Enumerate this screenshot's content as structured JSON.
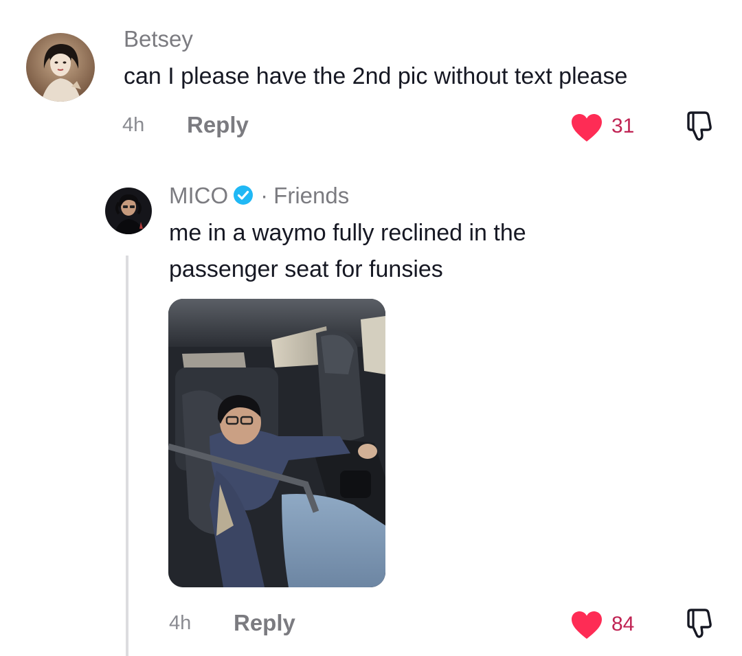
{
  "colors": {
    "like_heart": "#fe2c55",
    "like_count": "#c02454",
    "verified_badge": "#20b8f5",
    "muted_text": "#7b7b80"
  },
  "comments": [
    {
      "username": "Betsey",
      "text": "can I please have the 2nd pic without text please",
      "time": "4h",
      "reply_label": "Reply",
      "likes": "31",
      "liked": true,
      "icons": [
        "heart-icon",
        "dislike-icon"
      ]
    }
  ],
  "replies": [
    {
      "username": "MICO",
      "verified": true,
      "relation_separator": "·",
      "relation": "Friends",
      "text_line1": "me in a waymo fully reclined in the",
      "text_line2": "passenger seat for funsies",
      "time": "4h",
      "reply_label": "Reply",
      "likes": "84",
      "liked": true,
      "icons": [
        "verified-badge-icon",
        "heart-icon",
        "dislike-icon"
      ]
    }
  ]
}
